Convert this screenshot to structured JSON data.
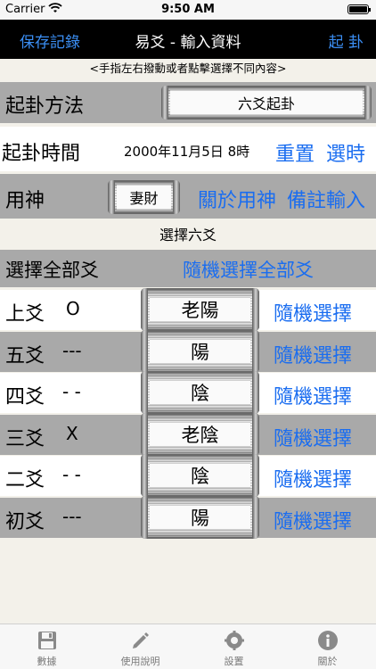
{
  "status_bar": {
    "carrier": "Carrier",
    "time": "9:50 AM"
  },
  "nav": {
    "left": "保存記錄",
    "title": "易爻 - 輸入資料",
    "right": "起 卦"
  },
  "hint": "<手指左右撥動或者點擊選擇不同內容>",
  "method": {
    "label": "起卦方法",
    "value": "六爻起卦"
  },
  "time_row": {
    "label": "起卦時間",
    "value": "2000年11月5日 8時",
    "reset": "重置",
    "select": "選時"
  },
  "yongshen": {
    "label": "用神",
    "value": "妻財",
    "about": "關於用神",
    "note": "備註輸入"
  },
  "section_title": "選擇六爻",
  "select_all": {
    "label": "選擇全部爻",
    "random_all": "隨機選擇全部爻"
  },
  "lines": [
    {
      "name": "上爻",
      "symbol": "O",
      "value": "老陽",
      "random": "隨機選擇"
    },
    {
      "name": "五爻",
      "symbol": "---",
      "value": "陽",
      "random": "隨機選擇"
    },
    {
      "name": "四爻",
      "symbol": "- -",
      "value": "陰",
      "random": "隨機選擇"
    },
    {
      "name": "三爻",
      "symbol": "X",
      "value": "老陰",
      "random": "隨機選擇"
    },
    {
      "name": "二爻",
      "symbol": "- -",
      "value": "陰",
      "random": "隨機選擇"
    },
    {
      "name": "初爻",
      "symbol": "---",
      "value": "陽",
      "random": "隨機選擇"
    }
  ],
  "tabs": [
    {
      "label": "數據",
      "icon": "floppy-disk-icon"
    },
    {
      "label": "使用說明",
      "icon": "pencil-icon"
    },
    {
      "label": "設置",
      "icon": "gear-icon"
    },
    {
      "label": "關於",
      "icon": "info-icon"
    }
  ],
  "colors": {
    "accent": "#1a6df0",
    "nav_bg": "#000000",
    "row_gray": "#a9a9a9"
  }
}
